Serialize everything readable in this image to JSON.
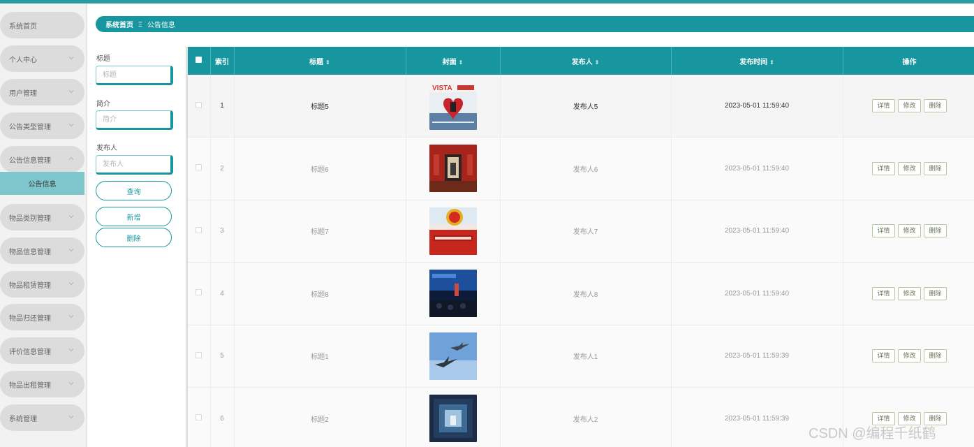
{
  "sidebar": {
    "items": [
      {
        "label": "系统首页",
        "has_arrow": false
      },
      {
        "label": "个人中心",
        "has_arrow": true
      },
      {
        "label": "用户管理",
        "has_arrow": true
      },
      {
        "label": "公告类型管理",
        "has_arrow": true
      },
      {
        "label": "公告信息管理",
        "has_arrow": true,
        "expanded": true
      },
      {
        "label": "物品类别管理",
        "has_arrow": true
      },
      {
        "label": "物品信息管理",
        "has_arrow": true
      },
      {
        "label": "物品租赁管理",
        "has_arrow": true
      },
      {
        "label": "物品归还管理",
        "has_arrow": true
      },
      {
        "label": "评价信息管理",
        "has_arrow": true
      },
      {
        "label": "物品出租管理",
        "has_arrow": true
      },
      {
        "label": "系统管理",
        "has_arrow": true
      }
    ],
    "active_sub": "公告信息"
  },
  "breadcrumb": {
    "home": "系统首页",
    "separator": "Ξ",
    "current": "公告信息"
  },
  "search": {
    "title_label": "标题",
    "title_placeholder": "标题",
    "intro_label": "简介",
    "intro_placeholder": "简介",
    "publisher_label": "发布人",
    "publisher_placeholder": "发布人",
    "query_button": "查询",
    "add_button": "新增",
    "delete_button": "删除"
  },
  "table": {
    "headers": {
      "index": "索引",
      "title": "标题",
      "cover": "封面",
      "publisher": "发布人",
      "time": "发布时间",
      "actions": "操作"
    },
    "rows": [
      {
        "index": "1",
        "title": "标题5",
        "publisher": "发布人5",
        "time": "2023-05-01 11:59:40",
        "cover": "magazine-heart"
      },
      {
        "index": "2",
        "title": "标题6",
        "publisher": "发布人6",
        "time": "2023-05-01 11:59:40",
        "cover": "red-hall"
      },
      {
        "index": "3",
        "title": "标题7",
        "publisher": "发布人7",
        "time": "2023-05-01 11:59:40",
        "cover": "party-emblem"
      },
      {
        "index": "4",
        "title": "标题8",
        "publisher": "发布人8",
        "time": "2023-05-01 11:59:40",
        "cover": "conference-stage"
      },
      {
        "index": "5",
        "title": "标题1",
        "publisher": "发布人1",
        "time": "2023-05-01 11:59:39",
        "cover": "fighter-jets"
      },
      {
        "index": "6",
        "title": "标题2",
        "publisher": "发布人2",
        "time": "2023-05-01 11:59:39",
        "cover": "space-module"
      }
    ],
    "action_labels": {
      "detail": "详情",
      "edit": "修改",
      "delete": "删除"
    }
  },
  "watermark": "CSDN @编程千纸鹤",
  "colors": {
    "primary": "#1796a0",
    "active_sub_bg": "#7fc6cc",
    "sidebar_pill": "#dcdcdc"
  }
}
